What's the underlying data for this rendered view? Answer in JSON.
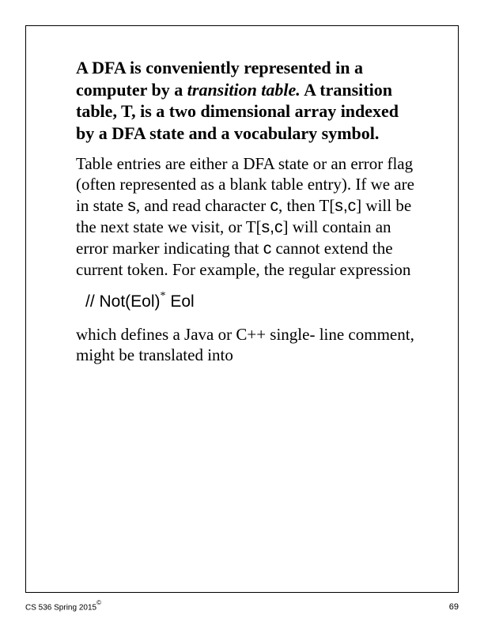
{
  "para1_part1": "A DFA is conveniently represented in a computer by a ",
  "para1_italic": "transition table.",
  "para1_part2": " A transition table, T, is a two dimensional array indexed by a DFA state and a vocabulary symbol.",
  "para2_part1": "Table entries are either a DFA state or an error flag (often represented as a blank table entry). If we are in state ",
  "para2_s1": "s",
  "para2_part2": ", and read character ",
  "para2_c1": "c",
  "para2_part3": ", then T[",
  "para2_s2": "s",
  "para2_comma1": ",",
  "para2_c2": "c",
  "para2_part4": "] will be the next state we visit, or T[",
  "para2_s3": "s",
  "para2_comma2": ",",
  "para2_c3": "c",
  "para2_part5": "] will contain an error marker indicating that ",
  "para2_c4": "c",
  "para2_part6": " cannot extend the current token. For example, the regular expression",
  "expr_slash": "//",
  "expr_noteol": "  Not(Eol)",
  "expr_star": "*",
  "expr_eol": " Eol",
  "para3": "which defines a Java or C++ single- line comment, might be translated into",
  "footer_left": "CS 536  Spring 2015",
  "footer_copy": "©",
  "footer_right": "69"
}
